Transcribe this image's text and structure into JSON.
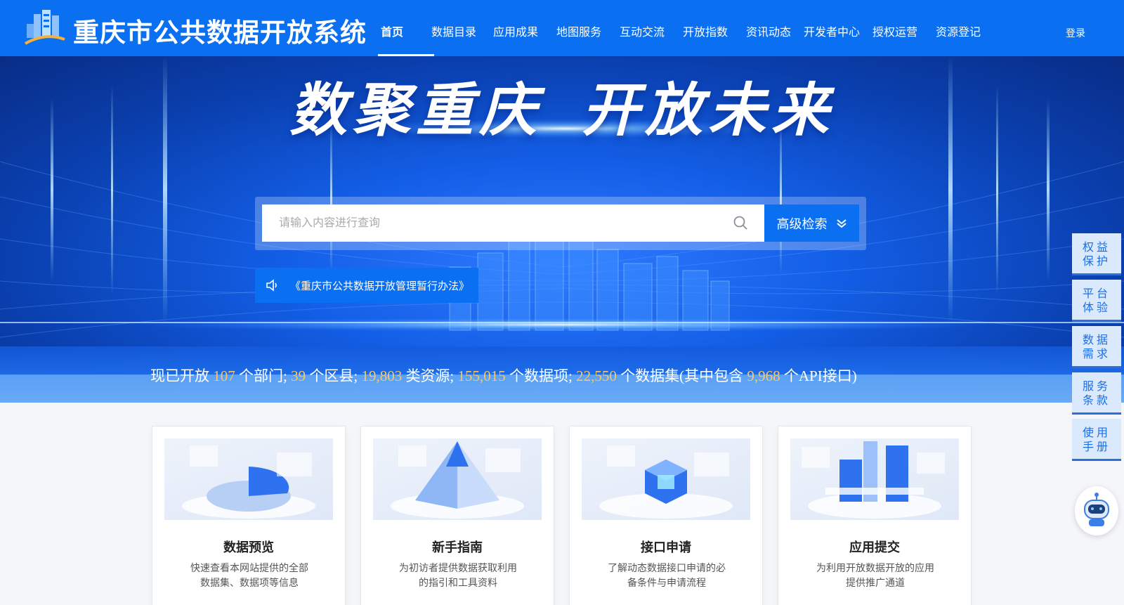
{
  "header": {
    "site_title": "重庆市公共数据开放系统",
    "nav": [
      {
        "label": "首页",
        "active": true
      },
      {
        "label": "数据目录"
      },
      {
        "label": "应用成果"
      },
      {
        "label": "地图服务"
      },
      {
        "label": "互动交流"
      },
      {
        "label": "开放指数"
      },
      {
        "label": "资讯动态"
      },
      {
        "label": "开发者中心"
      },
      {
        "label": "授权运营"
      },
      {
        "label": "资源登记"
      }
    ],
    "login_label": "登录"
  },
  "banner": {
    "slogan_left": "数聚重庆",
    "slogan_right": "开放未来",
    "search": {
      "placeholder": "请输入内容进行查询",
      "advanced_label": "高级检索"
    },
    "notice": "《重庆市公共数据开放管理暂行办法》"
  },
  "stats": {
    "prefix": "现已开放",
    "departments": "107",
    "departments_unit": "个部门;",
    "districts": "39",
    "districts_unit": "个区县;",
    "resources": "19,803",
    "resources_unit": "类资源;",
    "items": "155,015",
    "items_unit": "个数据项;",
    "datasets": "22,550",
    "datasets_unit": "个数据集(其中包含",
    "apis": "9,968",
    "apis_unit": "个API接口)"
  },
  "side_buttons": [
    {
      "line1": "权益",
      "line2": "保护"
    },
    {
      "line1": "平台",
      "line2": "体验"
    },
    {
      "line1": "数据",
      "line2": "需求"
    },
    {
      "line1": "服务",
      "line2": "条款"
    },
    {
      "line1": "使用",
      "line2": "手册"
    }
  ],
  "cards": [
    {
      "title": "数据预览",
      "desc": "快速查看本网站提供的全部数据集、数据项等信息"
    },
    {
      "title": "新手指南",
      "desc": "为初访者提供数据获取利用的指引和工具资料"
    },
    {
      "title": "接口申请",
      "desc": "了解动态数据接口申请的必备条件与申请流程"
    },
    {
      "title": "应用提交",
      "desc": "为利用开放数据开放的应用提供推广通道"
    }
  ],
  "colors": {
    "brand_blue": "#0a6ff0",
    "stat_highlight": "#f5c76a",
    "side_bg": "#dbe9fd"
  }
}
